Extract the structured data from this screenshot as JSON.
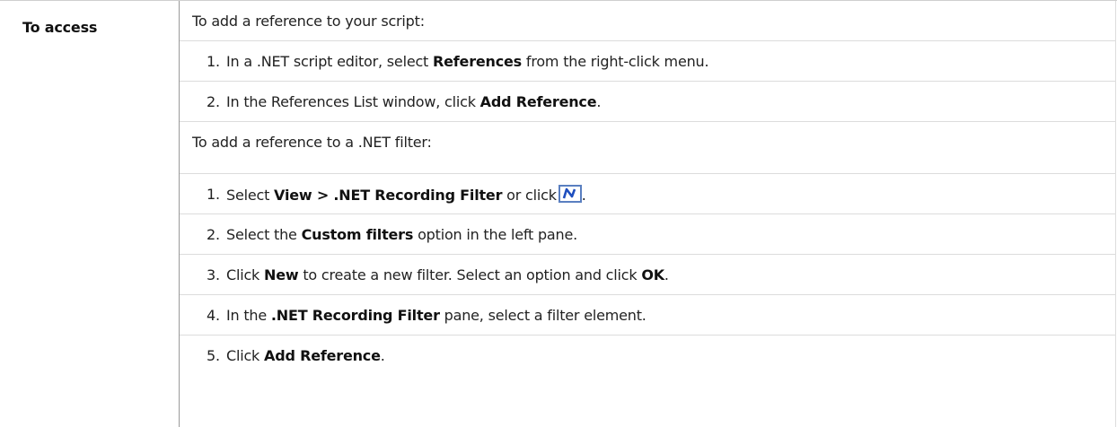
{
  "label": "To access",
  "script_section": {
    "intro": "To add a reference to your script:",
    "steps": [
      {
        "num": "1.",
        "pre": "In a .NET script editor, select ",
        "bold": "References",
        "post": " from the right-click menu."
      },
      {
        "num": "2.",
        "pre": "In the References List window, click ",
        "bold": "Add Reference",
        "post": "."
      }
    ]
  },
  "filter_section": {
    "intro": "To add a reference to a .NET filter:",
    "steps": [
      {
        "num": "1.",
        "pre": "Select ",
        "bold": "View > .NET Recording Filter",
        "post": " or click",
        "icon_end": "."
      },
      {
        "num": "2.",
        "pre": "Select the ",
        "bold": "Custom filters",
        "post": " option in the left pane."
      },
      {
        "num": "3.",
        "pre": "Click ",
        "bold": "New",
        "post": " to create a new filter. Select an option and click ",
        "bold2": "OK",
        "post2": "."
      },
      {
        "num": "4.",
        "pre": "In the ",
        "bold": ".NET Recording Filter",
        "post": " pane, select a filter element."
      },
      {
        "num": "5.",
        "pre": "Click ",
        "bold": "Add Reference",
        "post": "."
      }
    ]
  },
  "icons": {
    "net_filter": "net-recording-filter-icon"
  },
  "colors": {
    "icon_border": "#5a7fc0",
    "icon_glyph": "#1f4fbf"
  }
}
